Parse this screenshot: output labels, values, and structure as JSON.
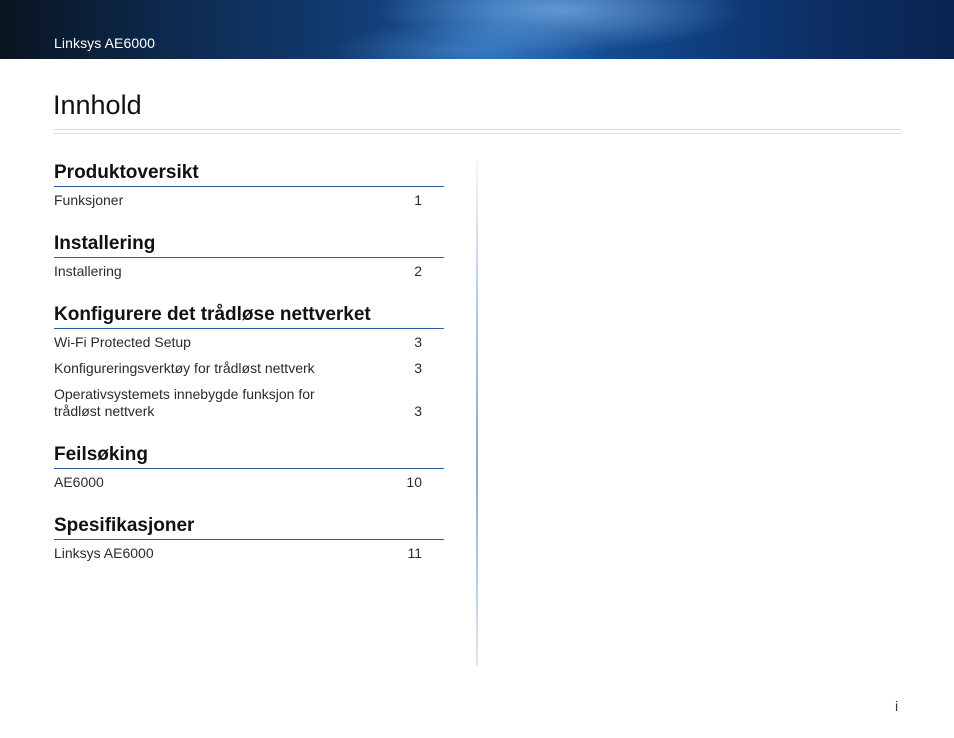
{
  "header": {
    "title": "Linksys AE6000"
  },
  "page": {
    "heading": "Innhold",
    "number": "i"
  },
  "sections": [
    {
      "title": "Produktoversikt",
      "entries": [
        {
          "label": "Funksjoner",
          "page": "1"
        }
      ]
    },
    {
      "title": "Installering",
      "entries": [
        {
          "label": "Installering",
          "page": "2"
        }
      ]
    },
    {
      "title": "Konfigurere det trådløse nettverket",
      "entries": [
        {
          "label": "Wi-Fi Protected Setup",
          "page": "3"
        },
        {
          "label": "Konfigureringsverktøy for trådløst nettverk",
          "page": "3"
        },
        {
          "label": "Operativsystemets innebygde funksjon for trådløst nettverk",
          "page": "3"
        }
      ]
    },
    {
      "title": "Feilsøking",
      "entries": [
        {
          "label": "AE6000",
          "page": "10"
        }
      ]
    },
    {
      "title": "Spesifikasjoner",
      "entries": [
        {
          "label": "Linksys AE6000",
          "page": "11"
        }
      ]
    }
  ]
}
